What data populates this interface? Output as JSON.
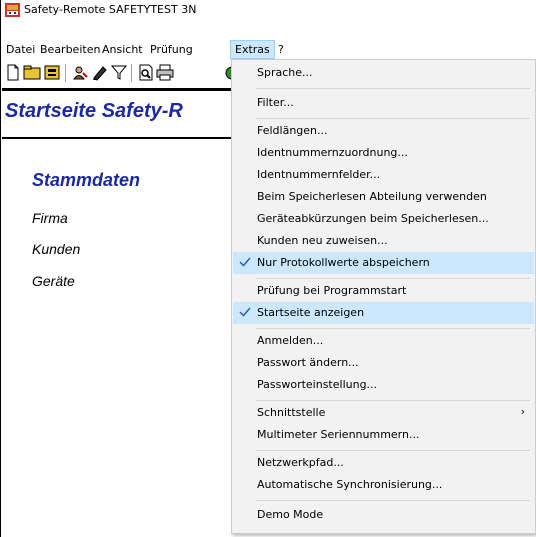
{
  "window": {
    "title": "Safety-Remote SAFETYTEST 3N"
  },
  "menubar": {
    "items": [
      {
        "label": "Datei"
      },
      {
        "label": "Bearbeiten"
      },
      {
        "label": "Ansicht"
      },
      {
        "label": "Prüfung"
      },
      {
        "label": "Extras"
      },
      {
        "label": "?"
      }
    ],
    "active": "Extras"
  },
  "toolbar": {
    "icons": [
      "new-document-icon",
      "open-folder-icon",
      "print-preview-icon",
      "user-key-icon",
      "edit-pen-icon",
      "filter-icon",
      "preview-icon",
      "print-icon",
      "green-status-icon"
    ]
  },
  "content": {
    "title": "Startseite  Safety-R",
    "section_heading": "Stammdaten",
    "links": [
      "Firma",
      "Kunden",
      "Geräte"
    ]
  },
  "extras_menu": {
    "items": [
      {
        "label": "Sprache..."
      },
      {
        "label": "Filter..."
      },
      {
        "label": "Feldlängen..."
      },
      {
        "label": "Identnummernzuordnung..."
      },
      {
        "label": "Identnummernfelder..."
      },
      {
        "label": "Beim Speicherlesen Abteilung verwenden"
      },
      {
        "label": "Geräteabkürzungen beim Speicherlesen..."
      },
      {
        "label": "Kunden neu zuweisen..."
      },
      {
        "label": "Nur Protokollwerte abspeichern",
        "checked": true
      },
      {
        "label": "Prüfung bei Programmstart"
      },
      {
        "label": "Startseite anzeigen",
        "checked": true
      },
      {
        "label": "Anmelden..."
      },
      {
        "label": "Passwort ändern..."
      },
      {
        "label": "Passworteinstellung..."
      },
      {
        "label": "Schnittstelle",
        "submenu": true,
        "arrow": "›"
      },
      {
        "label": "Multimeter Seriennummern..."
      },
      {
        "label": "Netzwerkpfad..."
      },
      {
        "label": "Automatische Synchronisierung..."
      },
      {
        "label": "Demo Mode"
      }
    ]
  },
  "colors": {
    "heading_blue": "#1c2aa0",
    "menu_highlight": "#cce8ff",
    "menu_bg": "#f2f2f2"
  }
}
